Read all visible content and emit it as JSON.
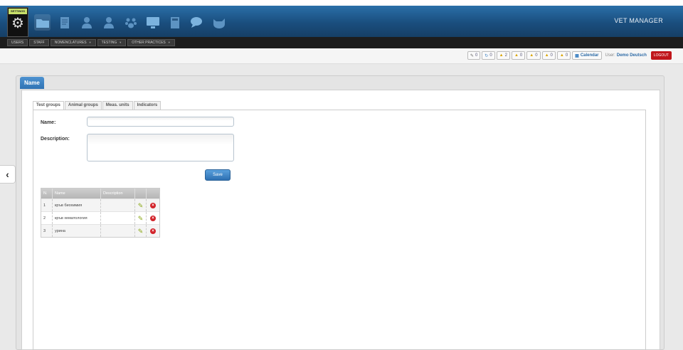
{
  "header": {
    "settings_label": "SETTINGS",
    "app_title": "VET MANAGER",
    "modules": [
      {
        "icon": "folder-icon"
      },
      {
        "icon": "document-icon"
      },
      {
        "icon": "person-icon"
      },
      {
        "icon": "person-alt-icon"
      },
      {
        "icon": "paw-icon"
      },
      {
        "icon": "monitor-icon"
      },
      {
        "icon": "book-icon"
      },
      {
        "icon": "chat-icon"
      },
      {
        "icon": "pet-icon"
      }
    ]
  },
  "nav": {
    "items": [
      {
        "label": "USERS",
        "has_menu": false
      },
      {
        "label": "STAFF",
        "has_menu": false
      },
      {
        "label": "NOMENCLATURES",
        "has_menu": true
      },
      {
        "label": "TESTING",
        "has_menu": true
      },
      {
        "label": "OTHER PRACTICES",
        "has_menu": true
      }
    ]
  },
  "toolbar": {
    "counters": [
      {
        "icon": "edit-icon",
        "value": "0"
      },
      {
        "icon": "refresh-icon",
        "value": "0"
      },
      {
        "icon": "warning-icon",
        "value": "2"
      },
      {
        "icon": "warning-icon",
        "value": "0"
      },
      {
        "icon": "warning-icon",
        "value": "0"
      },
      {
        "icon": "warning-icon",
        "value": "0"
      },
      {
        "icon": "warning-icon",
        "value": "0"
      }
    ],
    "calendar_label": "Calendar",
    "user_label": "User:",
    "user_name": "Demo Deutsch",
    "logout_label": "LOGOUT"
  },
  "panel": {
    "title": "Name",
    "tabs": [
      "Test groups",
      "Animal groups",
      "Meas. units",
      "Indicators"
    ],
    "active_tab": 0,
    "form": {
      "name_label": "Name:",
      "name_value": "",
      "description_label": "Description:",
      "description_value": "",
      "save_label": "Save"
    },
    "grid": {
      "headers": [
        "N.",
        "Name",
        "Description"
      ],
      "rows": [
        {
          "no": "1",
          "name": "кръв биохимия",
          "description": ""
        },
        {
          "no": "2",
          "name": "кръв хематология",
          "description": ""
        },
        {
          "no": "3",
          "name": "урина",
          "description": ""
        }
      ]
    }
  },
  "colors": {
    "header_blue": "#1a4e7e",
    "accent": "#2f73b4",
    "logout_red": "#c0161b",
    "delete_red": "#d2232a"
  }
}
